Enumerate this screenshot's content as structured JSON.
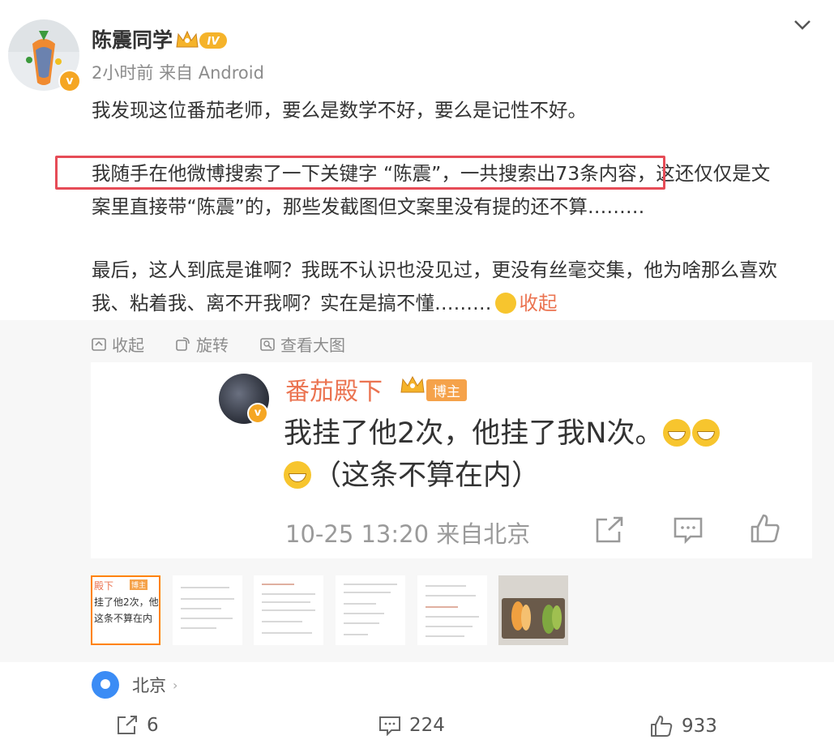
{
  "post": {
    "username": "陈震同学",
    "level_badge": "IV",
    "verified_mark": "v",
    "time": "2小时前",
    "source": "来自 Android",
    "para1": "我发现这位番茄老师，要么是数学不好，要么是记性不好。",
    "para2_line1": "我随手在他微博搜索了一下关键字 “陈震”，一共搜索出73条内容，这还仅仅是文",
    "para2_line2": "案里直接带“陈震”的，那些发截图但文案里没有提的还不算………",
    "para3_line1": "最后，这人到底是谁啊？我既不认识也没见过，更没有丝毫交集，他为啥那么喜欢",
    "para3_line2": "我、粘着我、离不开我啊？实在是搞不懂………",
    "collapse_inline": "收起"
  },
  "toolbar": {
    "collapse": "收起",
    "rotate": "旋转",
    "view_large": "查看大图"
  },
  "card": {
    "name": "番茄殿下",
    "badge": "博主",
    "verified_mark": "v",
    "line1": "我挂了他2次，他挂了我N次。",
    "line2": "（这条不算在内）",
    "time_source": "10-25 13:20 来自北京"
  },
  "thumbs": {
    "t1_name": "殿下",
    "t1_badge": "博主",
    "t1_line1": "挂了他2次，他",
    "t1_line2": "这条不算在内"
  },
  "location": {
    "name": "北京",
    "arrow": "›"
  },
  "actions": {
    "repost": "6",
    "comment": "224",
    "like": "933"
  },
  "colors": {
    "accent": "#eb7350",
    "highlight_box": "#e64c57",
    "verified": "#f5a623",
    "location_pin": "#3b8cf5"
  }
}
